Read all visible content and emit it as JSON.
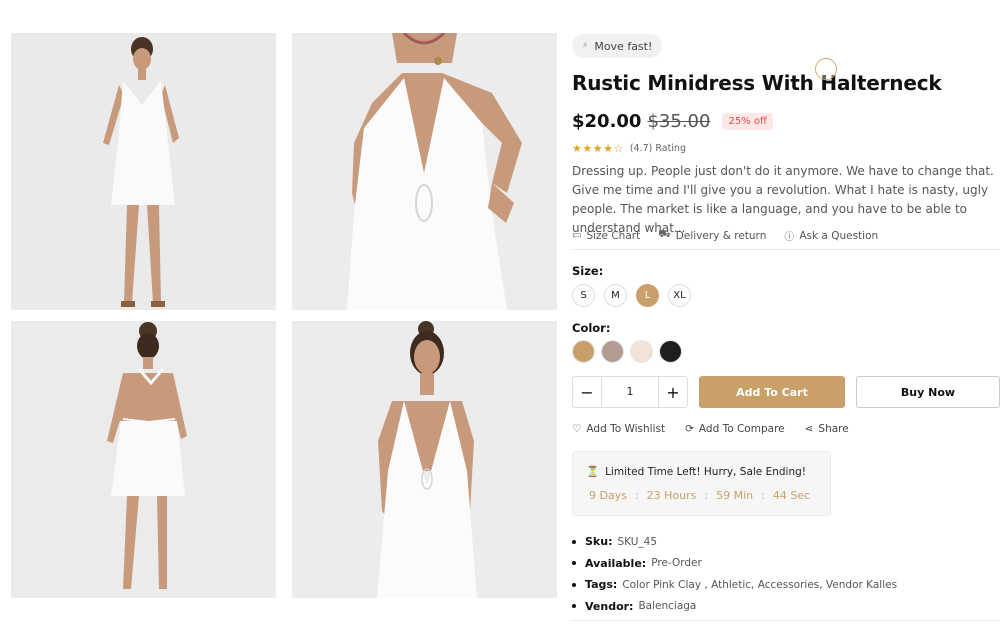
{
  "product": {
    "badge_text": "Move fast!",
    "title": "Rustic Minidress With Halterneck",
    "price": "$20.00",
    "old_price": "$35.00",
    "discount": "25% off",
    "rating_text": "(4.7) Rating",
    "stars": 4.7,
    "description": "Dressing up. People just don't do it anymore. We have to change that. Give me time and I'll give you a revolution. What I hate is nasty, ugly people. The market is like a language, and you have to be able to understand what..."
  },
  "links": {
    "size_chart": "Size Chart",
    "delivery": "Delivery & return",
    "question": "Ask a Question"
  },
  "size": {
    "label": "Size:",
    "options": [
      "S",
      "M",
      "L",
      "XL"
    ],
    "selected": "L"
  },
  "color": {
    "label": "Color:",
    "swatches": [
      "#c9a06a",
      "#b39c92",
      "#f1e2d5",
      "#1e1e1e"
    ]
  },
  "quantity": {
    "minus": "−",
    "value": "1",
    "plus": "+"
  },
  "buttons": {
    "add_to_cart": "Add To Cart",
    "buy_now": "Buy Now"
  },
  "actions": {
    "wishlist": "Add To Wishlist",
    "compare": "Add To Compare",
    "share": "Share"
  },
  "sale": {
    "title": "Limited Time Left! Hurry, Sale Ending!",
    "days": "9 Days",
    "hours": "23 Hours",
    "minutes": "59 Min",
    "seconds": "44 Sec",
    "sep": ":"
  },
  "meta": {
    "sku_label": "Sku:",
    "sku": "SKU_45",
    "available_label": "Available:",
    "available": "Pre-Order",
    "tags_label": "Tags:",
    "tags": "Color Pink Clay , Athletic, Accessories, Vendor Kalles",
    "vendor_label": "Vendor:",
    "vendor": "Balenciaga"
  },
  "colors": {
    "accent": "#c9a06a",
    "sale_badge_bg": "#fde7e7",
    "sale_badge_text": "#e24b4b",
    "star": "#e0a526"
  }
}
